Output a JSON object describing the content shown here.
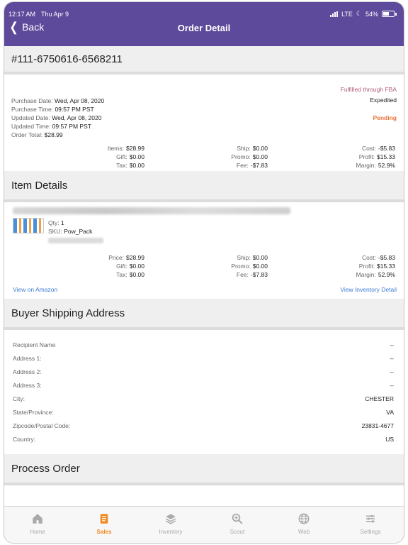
{
  "status": {
    "time": "12:17 AM",
    "date": "Thu Apr 9",
    "network": "LTE",
    "battery": "54%"
  },
  "nav": {
    "back_label": "Back",
    "title": "Order Detail"
  },
  "order": {
    "id": "#111-6750616-6568211",
    "fulfillment": "Fulfilled through FBA",
    "shipping": "Expedited",
    "status": "Pending",
    "purchase_date": {
      "label": "Purchase Date:",
      "value": "Wed, Apr 08, 2020"
    },
    "purchase_time": {
      "label": "Purchase Time:",
      "value": "09:57 PM PST"
    },
    "updated_date": {
      "label": "Updated Date:",
      "value": "Wed, Apr 08, 2020"
    },
    "updated_time": {
      "label": "Updated Time:",
      "value": "09:57 PM PST"
    },
    "order_total": {
      "label": "Order Total:",
      "value": "$28.99"
    },
    "financials": {
      "items": {
        "label": "Items:",
        "value": "$28.99"
      },
      "gift": {
        "label": "Gift:",
        "value": "$0.00"
      },
      "tax": {
        "label": "Tax:",
        "value": "$0.00"
      },
      "ship": {
        "label": "Ship:",
        "value": "$0.00"
      },
      "promo": {
        "label": "Promo:",
        "value": "$0.00"
      },
      "fee": {
        "label": "Fee:",
        "value": "-$7.83"
      },
      "cost": {
        "label": "Cost:",
        "value": "-$5.83"
      },
      "profit": {
        "label": "Profit:",
        "value": "$15.33"
      },
      "margin": {
        "label": "Margin:",
        "value": "52.9%"
      }
    }
  },
  "item_details": {
    "header": "Item Details",
    "qty": {
      "label": "Qty:",
      "value": "1"
    },
    "sku": {
      "label": "SKU:",
      "value": "Pow_Pack"
    },
    "price": {
      "label": "Price:",
      "value": "$28.99"
    },
    "gift": {
      "label": "Gift:",
      "value": "$0.00"
    },
    "tax": {
      "label": "Tax:",
      "value": "$0.00"
    },
    "ship": {
      "label": "Ship:",
      "value": "$0.00"
    },
    "promo": {
      "label": "Promo:",
      "value": "$0.00"
    },
    "fee": {
      "label": "Fee:",
      "value": "-$7.83"
    },
    "cost": {
      "label": "Cost:",
      "value": "-$5.83"
    },
    "profit": {
      "label": "Profit:",
      "value": "$15.33"
    },
    "margin": {
      "label": "Margin:",
      "value": "52.9%"
    },
    "view_amazon": "View on Amazon",
    "view_inventory": "View Inventory Detail"
  },
  "shipping_address": {
    "header": "Buyer Shipping Address",
    "rows": [
      {
        "label": "Recipient Name",
        "value": "--"
      },
      {
        "label": "Address 1:",
        "value": "--"
      },
      {
        "label": "Address 2:",
        "value": "--"
      },
      {
        "label": "Address 3:",
        "value": "--"
      },
      {
        "label": "City:",
        "value": "CHESTER"
      },
      {
        "label": "State/Province:",
        "value": "VA"
      },
      {
        "label": "Zipcode/Postal Code:",
        "value": "23831-4677"
      },
      {
        "label": "Country:",
        "value": "US"
      }
    ]
  },
  "process_order": {
    "header": "Process Order"
  },
  "tabbar": {
    "tabs": [
      {
        "label": "Home",
        "icon": "home-icon"
      },
      {
        "label": "Sales",
        "icon": "sales-icon"
      },
      {
        "label": "Inventory",
        "icon": "inventory-icon"
      },
      {
        "label": "Scout",
        "icon": "scout-icon"
      },
      {
        "label": "Web",
        "icon": "web-icon"
      },
      {
        "label": "Settings",
        "icon": "settings-icon"
      }
    ],
    "active": "Sales"
  },
  "colors": {
    "header": "#5e4a9b",
    "active_tab": "#f08a24",
    "pending": "#e8733a",
    "fba": "#b05a7a",
    "link": "#3a7bd5"
  }
}
